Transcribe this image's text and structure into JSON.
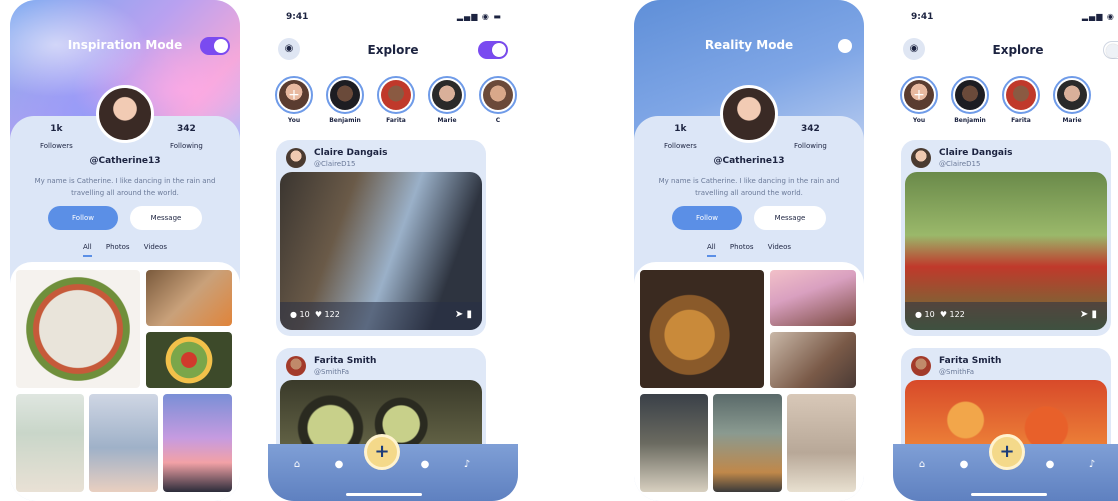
{
  "inspiration_profile": {
    "mode_title": "Inspiration Mode",
    "toggle_on": true,
    "followers_count": "1k",
    "followers_label": "Followers",
    "following_count": "342",
    "following_label": "Following",
    "username": "@Catherine13",
    "bio": "My name is Catherine. I like dancing in the rain and travelling all around the world.",
    "follow_label": "Follow",
    "message_label": "Message",
    "tabs": [
      "All",
      "Photos",
      "Videos"
    ]
  },
  "reality_profile": {
    "mode_title": "Reality Mode",
    "toggle_on": false,
    "followers_count": "1k",
    "followers_label": "Followers",
    "following_count": "342",
    "following_label": "Following",
    "username": "@Catherine13",
    "bio": "My name is Catherine. I like dancing in the rain and travelling all around the world.",
    "follow_label": "Follow",
    "message_label": "Message",
    "tabs": [
      "All",
      "Photos",
      "Videos"
    ]
  },
  "explore_inspiration": {
    "status_time": "9:41",
    "title": "Explore",
    "toggle_on": true,
    "stories": [
      "You",
      "Benjamin",
      "Farita",
      "Marie",
      "C"
    ],
    "posts": [
      {
        "name": "Claire Dangais",
        "username": "@ClaireD15",
        "comments": "10",
        "likes": "122"
      },
      {
        "name": "Farita Smith",
        "username": "@SmithFa"
      }
    ]
  },
  "explore_reality": {
    "status_time": "9:41",
    "title": "Explore",
    "toggle_on": false,
    "stories": [
      "You",
      "Benjamin",
      "Farita",
      "Marie"
    ],
    "posts": [
      {
        "name": "Claire Dangais",
        "username": "@ClaireD15",
        "comments": "10",
        "likes": "122"
      },
      {
        "name": "Farita Smith",
        "username": "@SmithFa"
      }
    ]
  },
  "colors": {
    "accent": "#5b8fe6",
    "toggle_on": "#7a4bf0",
    "text_dark": "#1c2340",
    "text_muted": "#6b7a99",
    "card_bg": "#dfe8f7",
    "fab": "#f4d98a"
  },
  "icons": {
    "camera": "camera-icon",
    "comment": "comment-icon",
    "heart": "heart-icon",
    "send": "send-icon",
    "bookmark": "bookmark-icon",
    "home": "home-icon",
    "chat": "chat-icon",
    "plus": "plus-icon",
    "user": "user-icon",
    "bell": "bell-icon"
  }
}
